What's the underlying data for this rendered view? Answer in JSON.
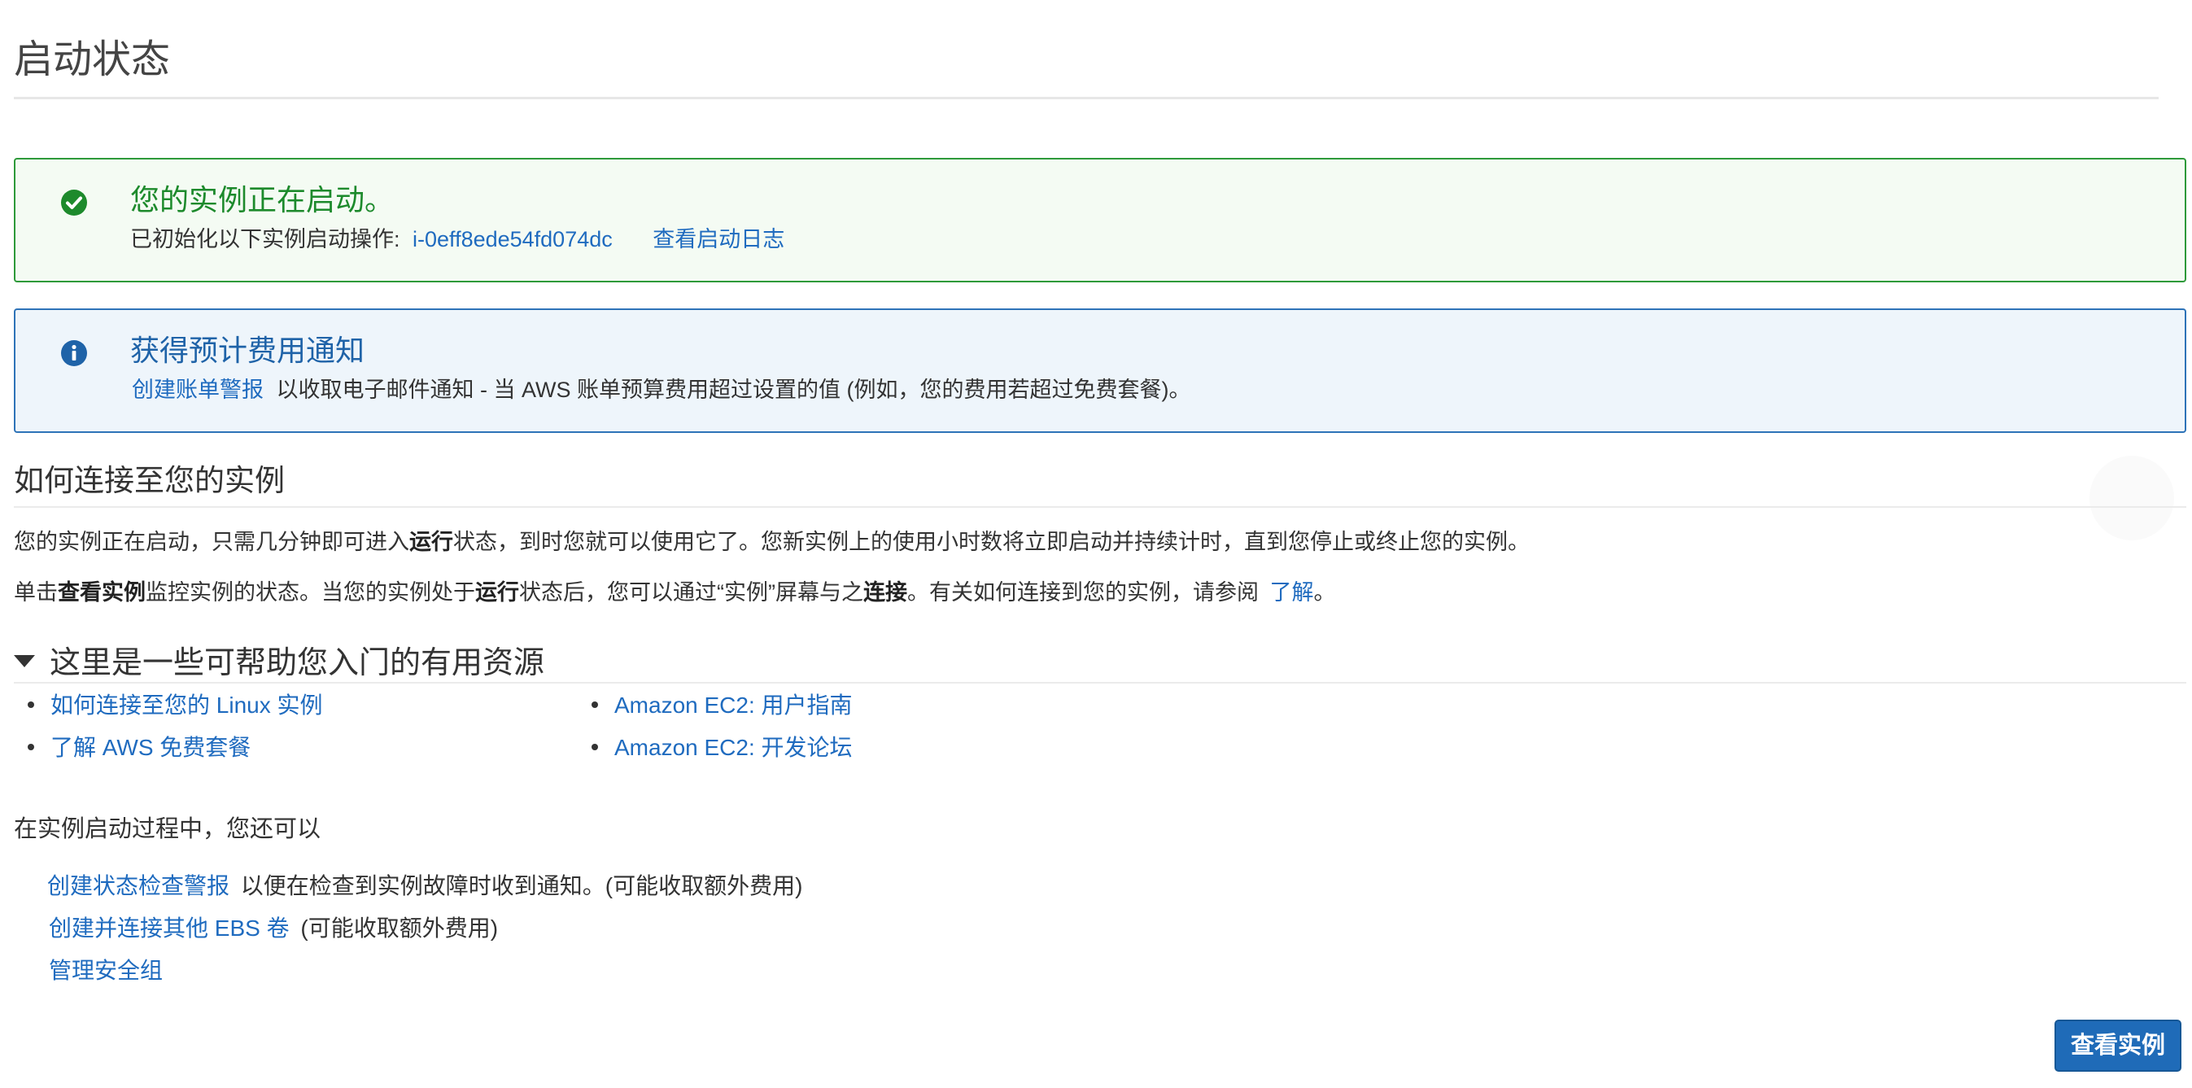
{
  "page": {
    "title": "启动状态"
  },
  "success_alert": {
    "icon": "check-circle-icon",
    "color": "#2e9a3a",
    "heading": "您的实例正在启动。",
    "body_prefix": "已初始化以下实例启动操作:",
    "instance_id": "i-0eff8ede54fd074dc",
    "log_link": "查看启动日志"
  },
  "info_alert": {
    "icon": "info-circle-icon",
    "color": "#2e73b8",
    "heading": "获得预计费用通知",
    "link": "创建账单警报",
    "body_text": "以收取电子邮件通知 - 当 AWS 账单预算费用超过设置的值 (例如，您的费用若超过免费套餐)。"
  },
  "connect_section": {
    "heading": "如何连接至您的实例",
    "para1": {
      "part1": "您的实例正在启动，只需几分钟即可进入",
      "bold1": "运行",
      "part2": "状态，到时您就可以使用它了。您新实例上的使用小时数将立即启动并持续计时，直到您停止或终止您的实例。"
    },
    "para2": {
      "part1": "单击",
      "bold1": "查看实例",
      "part2": "监控实例的状态。当您的实例处于",
      "bold2": "运行",
      "part3": "状态后，您可以通过“实例”屏幕与之",
      "bold3": "连接",
      "part4": "。有关如何连接到您的实例，请参阅",
      "link": "了解",
      "part5": "。"
    }
  },
  "resources": {
    "heading": "这里是一些可帮助您入门的有用资源",
    "left": [
      "如何连接至您的 Linux 实例",
      "了解 AWS 免费套餐"
    ],
    "right": [
      "Amazon EC2: 用户指南",
      "Amazon EC2: 开发论坛"
    ]
  },
  "also": {
    "heading": "在实例启动过程中，您还可以",
    "items": [
      {
        "link": "创建状态检查警报",
        "text": "以便在检查到实例故障时收到通知。(可能收取额外费用)"
      },
      {
        "link": "创建并连接其他 EBS 卷",
        "text": "(可能收取额外费用)"
      },
      {
        "link": "管理安全组",
        "text": ""
      }
    ]
  },
  "footer": {
    "view_instances_button": "查看实例",
    "button_color": "#1f6bb8"
  }
}
